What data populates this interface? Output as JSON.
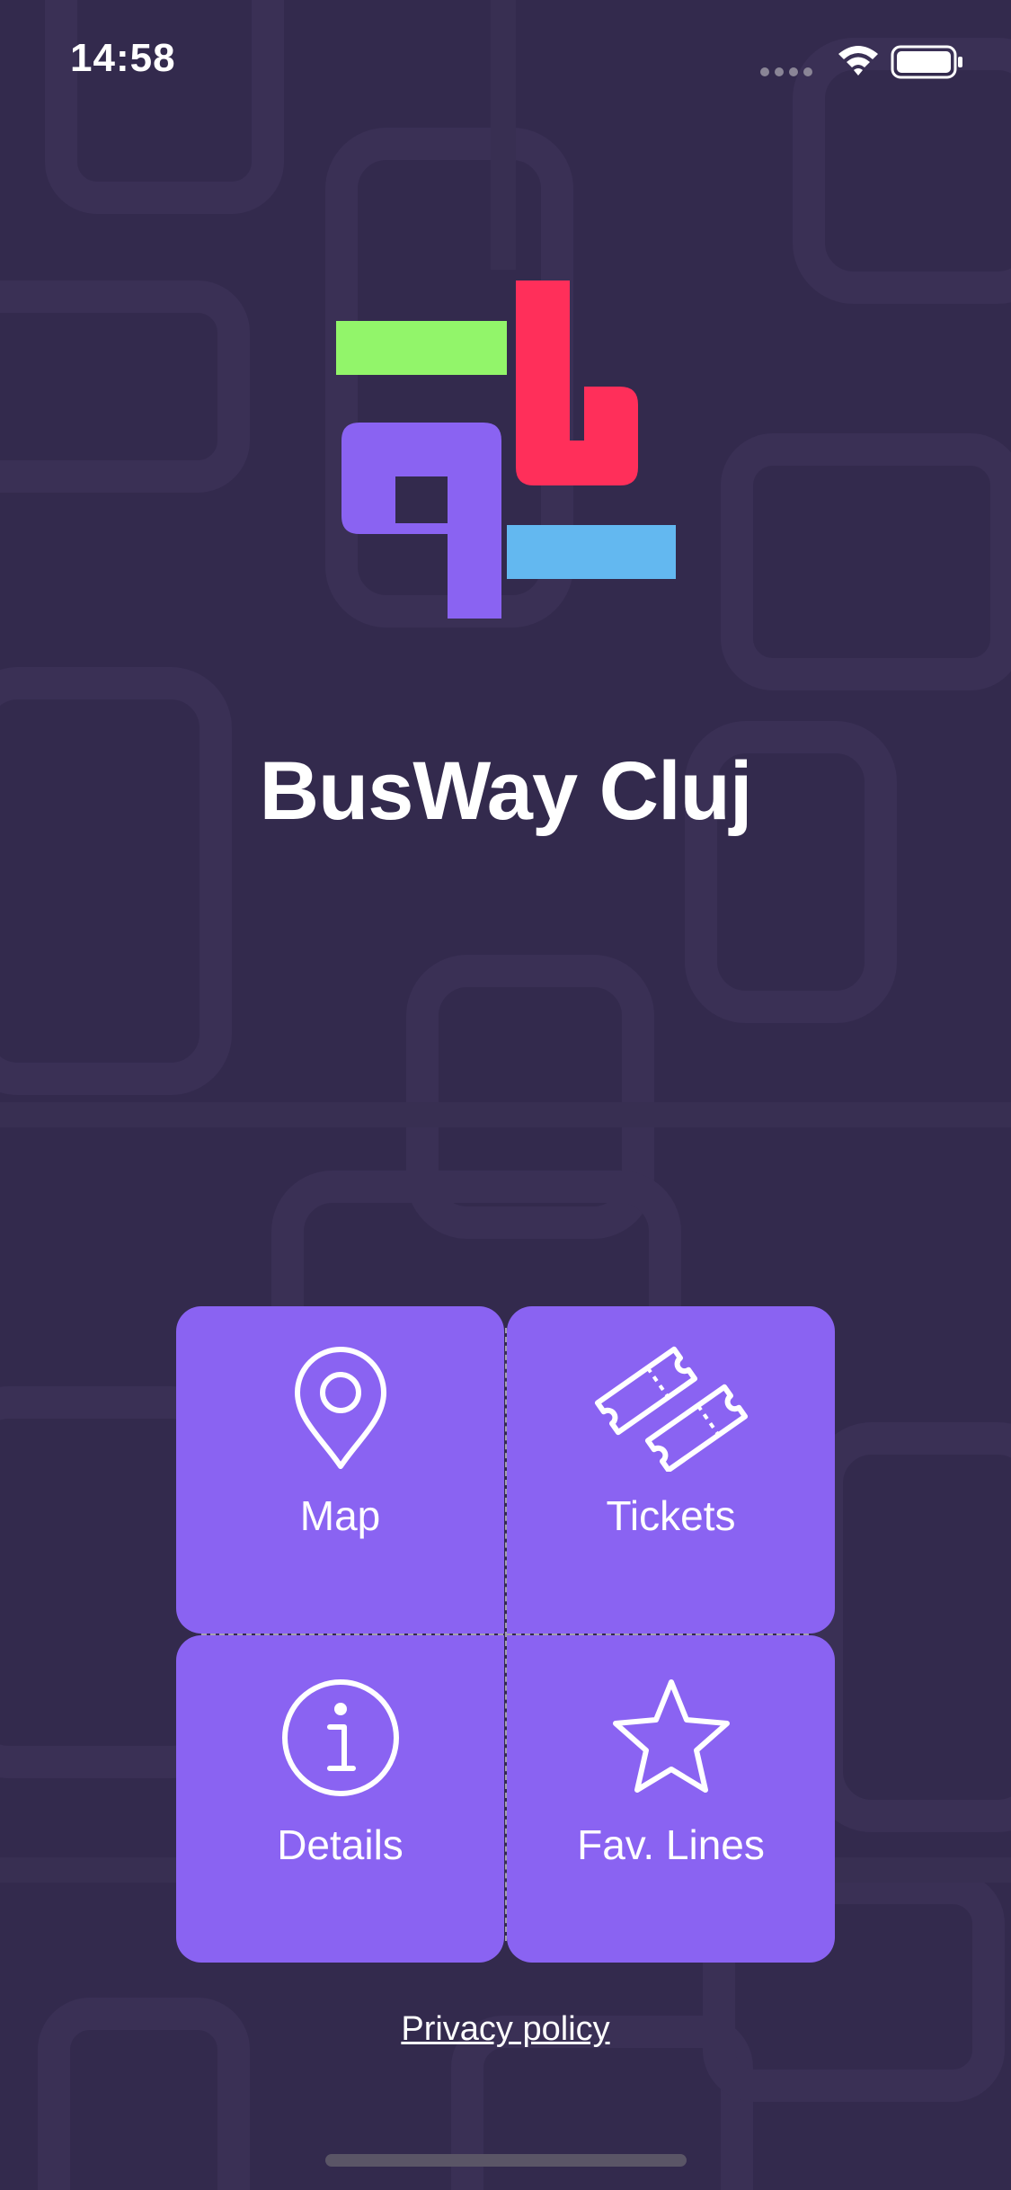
{
  "status_bar": {
    "time": "14:58",
    "icons": [
      "cellular-signal-icon",
      "wifi-icon",
      "battery-icon"
    ]
  },
  "app": {
    "title": "BusWay Cluj",
    "logo": "busway-logo"
  },
  "menu": {
    "items": [
      {
        "label": "Map",
        "icon": "map-pin-icon"
      },
      {
        "label": "Tickets",
        "icon": "tickets-icon"
      },
      {
        "label": "Details",
        "icon": "info-icon"
      },
      {
        "label": "Fav. Lines",
        "icon": "star-icon"
      }
    ]
  },
  "footer": {
    "privacy_label": "Privacy policy"
  },
  "colors": {
    "background": "#332a4d",
    "tile": "#8a63f2",
    "logo_green": "#92f56a",
    "logo_red": "#ff2f5a",
    "logo_purple": "#8a63f2",
    "logo_blue": "#63b8f0"
  }
}
